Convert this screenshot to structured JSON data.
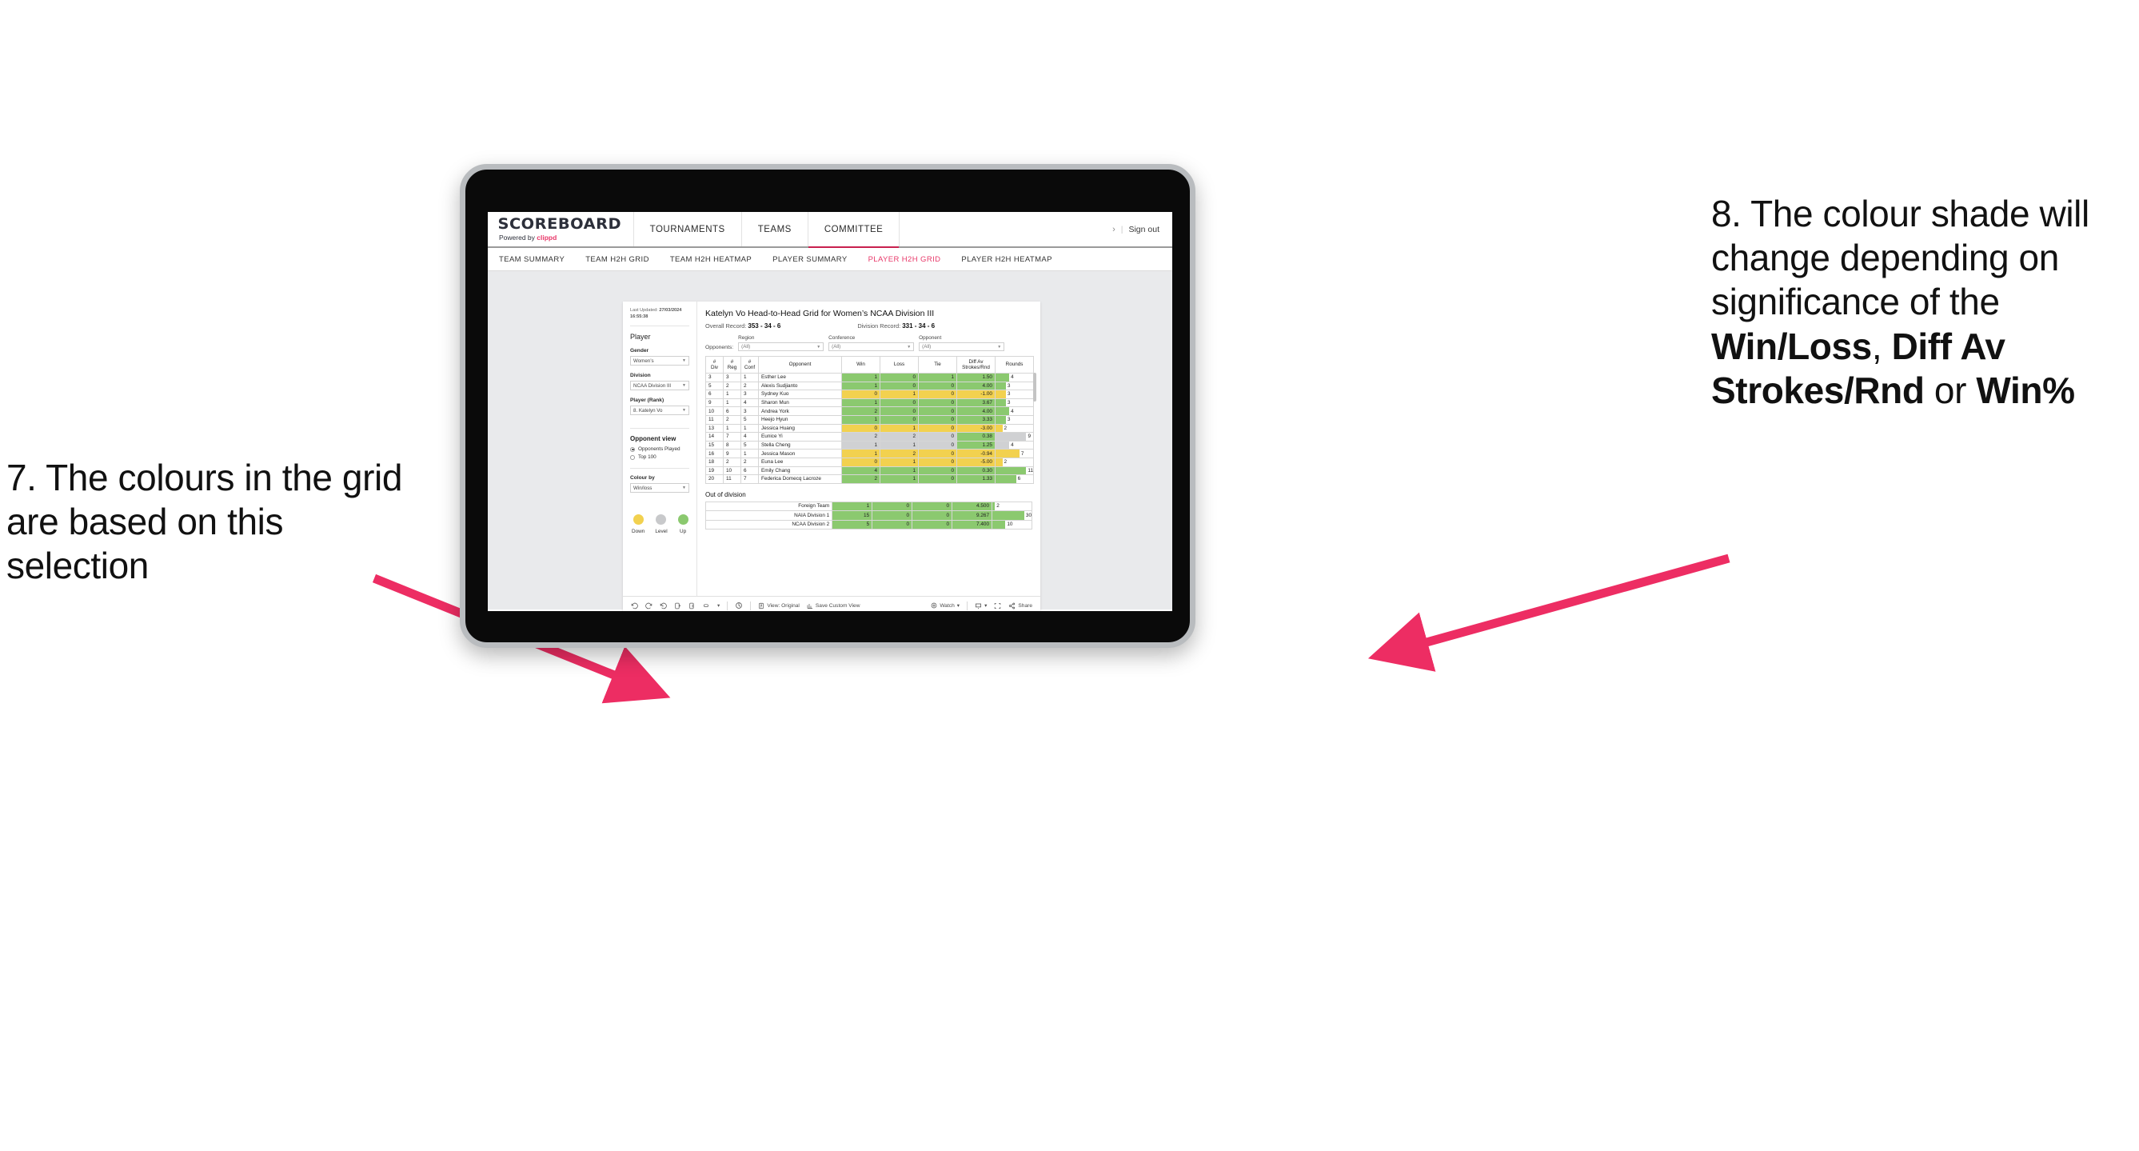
{
  "annotations": {
    "left": {
      "id": "annotation-7",
      "text": "7. The colours in the grid are based on this selection"
    },
    "right": {
      "id": "annotation-8",
      "lead": "8. The colour shade will change depending on significance of the ",
      "bold1": "Win/Loss",
      "mid1": ", ",
      "bold2": "Diff Av Strokes/Rnd",
      "mid2": " or ",
      "bold3": "Win%"
    },
    "arrow_color": "#ED2D63"
  },
  "brand": {
    "name": "SCOREBOARD",
    "powered_prefix": "Powered by ",
    "powered_name": "clippd"
  },
  "topnav": {
    "items": [
      {
        "label": "TOURNAMENTS",
        "active": false
      },
      {
        "label": "TEAMS",
        "active": false
      },
      {
        "label": "COMMITTEE",
        "active": true
      }
    ],
    "chevron": "›",
    "divider": "|",
    "signout": "Sign out"
  },
  "subnav": {
    "items": [
      {
        "label": "TEAM SUMMARY",
        "active": false
      },
      {
        "label": "TEAM H2H GRID",
        "active": false
      },
      {
        "label": "TEAM H2H HEATMAP",
        "active": false
      },
      {
        "label": "PLAYER SUMMARY",
        "active": false
      },
      {
        "label": "PLAYER H2H GRID",
        "active": true
      },
      {
        "label": "PLAYER H2H HEATMAP",
        "active": false
      }
    ],
    "active_color": "#e8396a"
  },
  "sidebar": {
    "last_updated_label": "Last Updated: ",
    "last_updated_value": "27/03/2024 16:55:38",
    "player_heading": "Player",
    "fields": [
      {
        "label": "Gender",
        "value": "Women’s"
      },
      {
        "label": "Division",
        "value": "NCAA Division III"
      },
      {
        "label": "Player (Rank)",
        "value": "8. Katelyn Vo"
      }
    ],
    "opponent_view": {
      "heading": "Opponent view",
      "options": [
        {
          "label": "Opponents Played",
          "selected": true
        },
        {
          "label": "Top 100",
          "selected": false
        }
      ]
    },
    "colour_by": {
      "label": "Colour by",
      "value": "Win/loss"
    },
    "legend": [
      {
        "caption": "Down",
        "color": "#F2D14F"
      },
      {
        "caption": "Level",
        "color": "#C8C9CB"
      },
      {
        "caption": "Up",
        "color": "#8BC96F"
      }
    ]
  },
  "main": {
    "title": "Katelyn Vo Head-to-Head Grid for Women’s NCAA Division III",
    "overall_record_label": "Overall Record: ",
    "overall_record_value": "353 -  34 - 6",
    "division_record_label": "Division Record: ",
    "division_record_value": "331 -  34 - 6",
    "opponents_label": "Opponents:",
    "filters": [
      {
        "label": "Region",
        "value": "(All)"
      },
      {
        "label": "Conference",
        "value": "(All)"
      },
      {
        "label": "Opponent",
        "value": "(All)"
      }
    ],
    "out_of_division_title": "Out of division"
  },
  "chart_data": {
    "type": "table",
    "title": "Katelyn Vo Head-to-Head Grid for Women’s NCAA Division III",
    "columns": [
      "# Div",
      "# Reg",
      "# Conf",
      "Opponent",
      "Win",
      "Loss",
      "Tie",
      "Diff Av Strokes/Rnd",
      "Rounds"
    ],
    "column_header_lines": [
      [
        "#",
        "Div"
      ],
      [
        "#",
        "Reg"
      ],
      [
        "#",
        "Conf"
      ],
      [
        "Opponent",
        ""
      ],
      [
        "Win",
        ""
      ],
      [
        "Loss",
        ""
      ],
      [
        "Tie",
        ""
      ],
      [
        "Diff Av",
        "Strokes/Rnd"
      ],
      [
        "Rounds",
        ""
      ]
    ],
    "colors": {
      "up": "#8BC96F",
      "down": "#F2D14F",
      "level": "#D0D1D3",
      "none": "#FFFFFF"
    },
    "rounds_max": 11,
    "rows": [
      {
        "div": "3",
        "reg": "3",
        "conf": "1",
        "opponent": "Esther Lee",
        "win": "1",
        "loss": "0",
        "tie": "1",
        "diff": "1.50",
        "rounds": "4",
        "state": "up"
      },
      {
        "div": "5",
        "reg": "2",
        "conf": "2",
        "opponent": "Alexis Sudjianto",
        "win": "1",
        "loss": "0",
        "tie": "0",
        "diff": "4.00",
        "rounds": "3",
        "state": "up"
      },
      {
        "div": "6",
        "reg": "1",
        "conf": "3",
        "opponent": "Sydney Kuo",
        "win": "0",
        "loss": "1",
        "tie": "0",
        "diff": "-1.00",
        "rounds": "3",
        "state": "down"
      },
      {
        "div": "9",
        "reg": "1",
        "conf": "4",
        "opponent": "Sharon Mun",
        "win": "1",
        "loss": "0",
        "tie": "0",
        "diff": "3.67",
        "rounds": "3",
        "state": "up"
      },
      {
        "div": "10",
        "reg": "6",
        "conf": "3",
        "opponent": "Andrea York",
        "win": "2",
        "loss": "0",
        "tie": "0",
        "diff": "4.00",
        "rounds": "4",
        "state": "up"
      },
      {
        "div": "11",
        "reg": "2",
        "conf": "5",
        "opponent": "Heejo Hyun",
        "win": "1",
        "loss": "0",
        "tie": "0",
        "diff": "3.33",
        "rounds": "3",
        "state": "up"
      },
      {
        "div": "13",
        "reg": "1",
        "conf": "1",
        "opponent": "Jessica Huang",
        "win": "0",
        "loss": "1",
        "tie": "0",
        "diff": "-3.00",
        "rounds": "2",
        "state": "down"
      },
      {
        "div": "14",
        "reg": "7",
        "conf": "4",
        "opponent": "Eunice Yi",
        "win": "2",
        "loss": "2",
        "tie": "0",
        "diff": "0.38",
        "rounds": "9",
        "state": "level",
        "diff_state": "up"
      },
      {
        "div": "15",
        "reg": "8",
        "conf": "5",
        "opponent": "Stella Cheng",
        "win": "1",
        "loss": "1",
        "tie": "0",
        "diff": "1.25",
        "rounds": "4",
        "state": "level",
        "diff_state": "up"
      },
      {
        "div": "16",
        "reg": "9",
        "conf": "1",
        "opponent": "Jessica Mason",
        "win": "1",
        "loss": "2",
        "tie": "0",
        "diff": "-0.94",
        "rounds": "7",
        "state": "down"
      },
      {
        "div": "18",
        "reg": "2",
        "conf": "2",
        "opponent": "Euna Lee",
        "win": "0",
        "loss": "1",
        "tie": "0",
        "diff": "-5.00",
        "rounds": "2",
        "state": "down"
      },
      {
        "div": "19",
        "reg": "10",
        "conf": "6",
        "opponent": "Emily Chang",
        "win": "4",
        "loss": "1",
        "tie": "0",
        "diff": "0.30",
        "rounds": "11",
        "state": "up"
      },
      {
        "div": "20",
        "reg": "11",
        "conf": "7",
        "opponent": "Federica Domecq Lacroze",
        "win": "2",
        "loss": "1",
        "tie": "0",
        "diff": "1.33",
        "rounds": "6",
        "state": "up"
      }
    ],
    "out_of_division": {
      "title": "Out of division",
      "rounds_max": 30,
      "rows": [
        {
          "name": "Foreign Team",
          "win": "1",
          "loss": "0",
          "tie": "0",
          "diff": "4.500",
          "rounds": "2",
          "state": "up"
        },
        {
          "name": "NAIA Division 1",
          "win": "15",
          "loss": "0",
          "tie": "0",
          "diff": "9.267",
          "rounds": "30",
          "state": "up"
        },
        {
          "name": "NCAA Division 2",
          "win": "5",
          "loss": "0",
          "tie": "0",
          "diff": "7.400",
          "rounds": "10",
          "state": "up"
        }
      ]
    }
  },
  "toolbar": {
    "view_original": "View: Original",
    "save_custom_view": "Save Custom View",
    "watch": "Watch",
    "share": "Share",
    "caret": "▾"
  }
}
